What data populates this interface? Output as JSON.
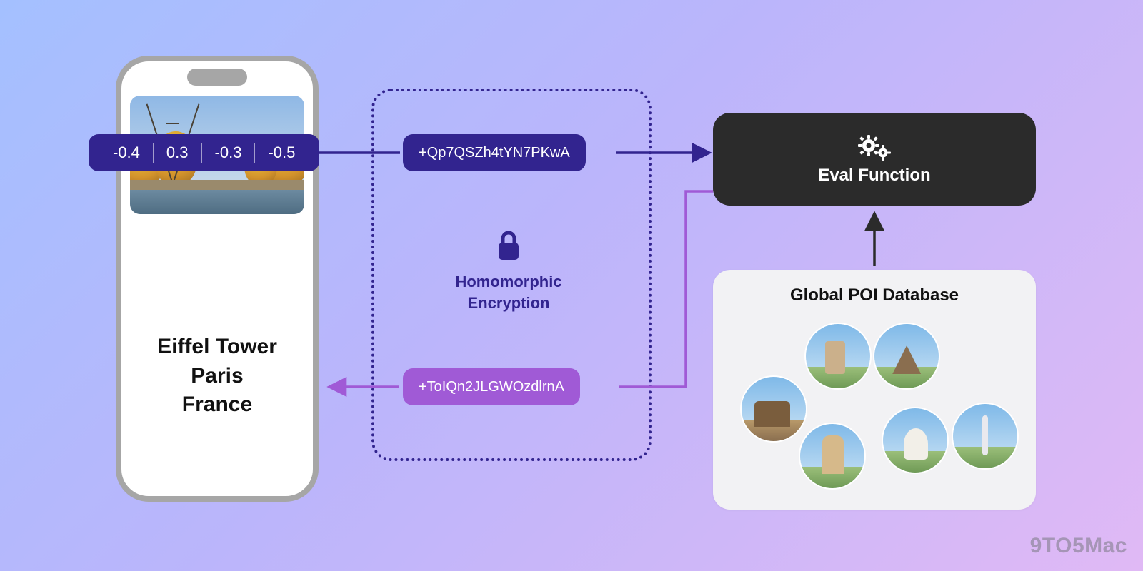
{
  "phone": {
    "result_lines": [
      "Eiffel Tower",
      "Paris",
      "France"
    ],
    "photo_alt": "Eiffel Tower seen across the Seine with autumn trees"
  },
  "vector": {
    "values": [
      "-0.4",
      "0.3",
      "-0.3",
      "-0.5"
    ]
  },
  "encryption": {
    "label_line1": "Homomorphic",
    "label_line2": "Encryption",
    "cipher_out": "+Qp7QSZh4tYN7PKwA",
    "cipher_in": "+ToIQn2JLGWOzdlrnA"
  },
  "eval_box": {
    "label": "Eval Function",
    "icon": "gears-icon"
  },
  "database": {
    "title": "Global POI Database",
    "items": [
      "Paris skyline",
      "Eiffel Tower close-up",
      "Angkor Wat",
      "Sagrada Família",
      "Taj Mahal",
      "Washington Monument / obelisk"
    ]
  },
  "colors": {
    "indigo": "#32248f",
    "purple": "#a05ad6",
    "eval_bg": "#2b2b2b",
    "db_bg": "#f2f2f4"
  },
  "watermark": "9TO5Mac"
}
